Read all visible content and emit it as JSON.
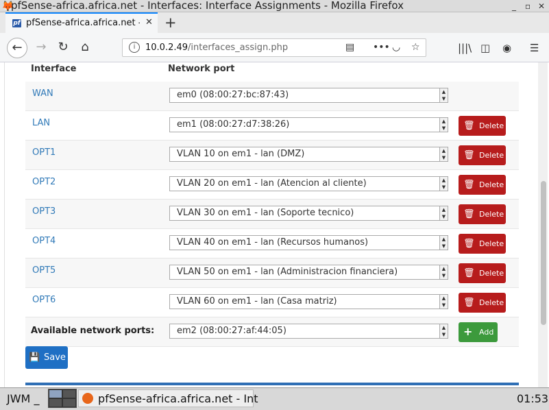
{
  "window": {
    "title": "pfSense-africa.africa.net - Interfaces: Interface Assignments - Mozilla Firefox",
    "controls": [
      "_",
      "▫",
      "✕"
    ]
  },
  "browser": {
    "tab_label": "pfSense-africa.africa.net -",
    "tab_favicon": "pf",
    "url_host": "10.0.2.49",
    "url_path": "/interfaces_assign.php"
  },
  "table": {
    "headers": {
      "interface": "Interface",
      "port": "Network port"
    },
    "rows": [
      {
        "name": "WAN",
        "port": "em0 (08:00:27:bc:87:43)",
        "delete": false
      },
      {
        "name": "LAN",
        "port": "em1 (08:00:27:d7:38:26)",
        "delete": true
      },
      {
        "name": "OPT1",
        "port": "VLAN 10 on em1 - lan (DMZ)",
        "delete": true
      },
      {
        "name": "OPT2",
        "port": "VLAN 20 on em1 - lan (Atencion al cliente)",
        "delete": true
      },
      {
        "name": "OPT3",
        "port": "VLAN 30 on em1 - lan (Soporte tecnico)",
        "delete": true
      },
      {
        "name": "OPT4",
        "port": "VLAN 40 on em1 - lan (Recursos humanos)",
        "delete": true
      },
      {
        "name": "OPT5",
        "port": "VLAN 50 on em1 - lan (Administracion financiera)",
        "delete": true
      },
      {
        "name": "OPT6",
        "port": "VLAN 60 on em1 - lan (Casa matriz)",
        "delete": true
      }
    ],
    "delete_label": "Delete",
    "available_label": "Available network ports:",
    "available_value": "em2 (08:00:27:af:44:05)",
    "add_label": "Add"
  },
  "save_label": "Save",
  "taskbar": {
    "wm": "JWM",
    "wm_sep": "_",
    "task_label": "pfSense-africa.africa.net - Int",
    "clock": "01:53"
  },
  "colors": {
    "delete": "#b71c1c",
    "add": "#3c9a3c",
    "save": "#1e6fc4",
    "link": "#317ab8"
  }
}
